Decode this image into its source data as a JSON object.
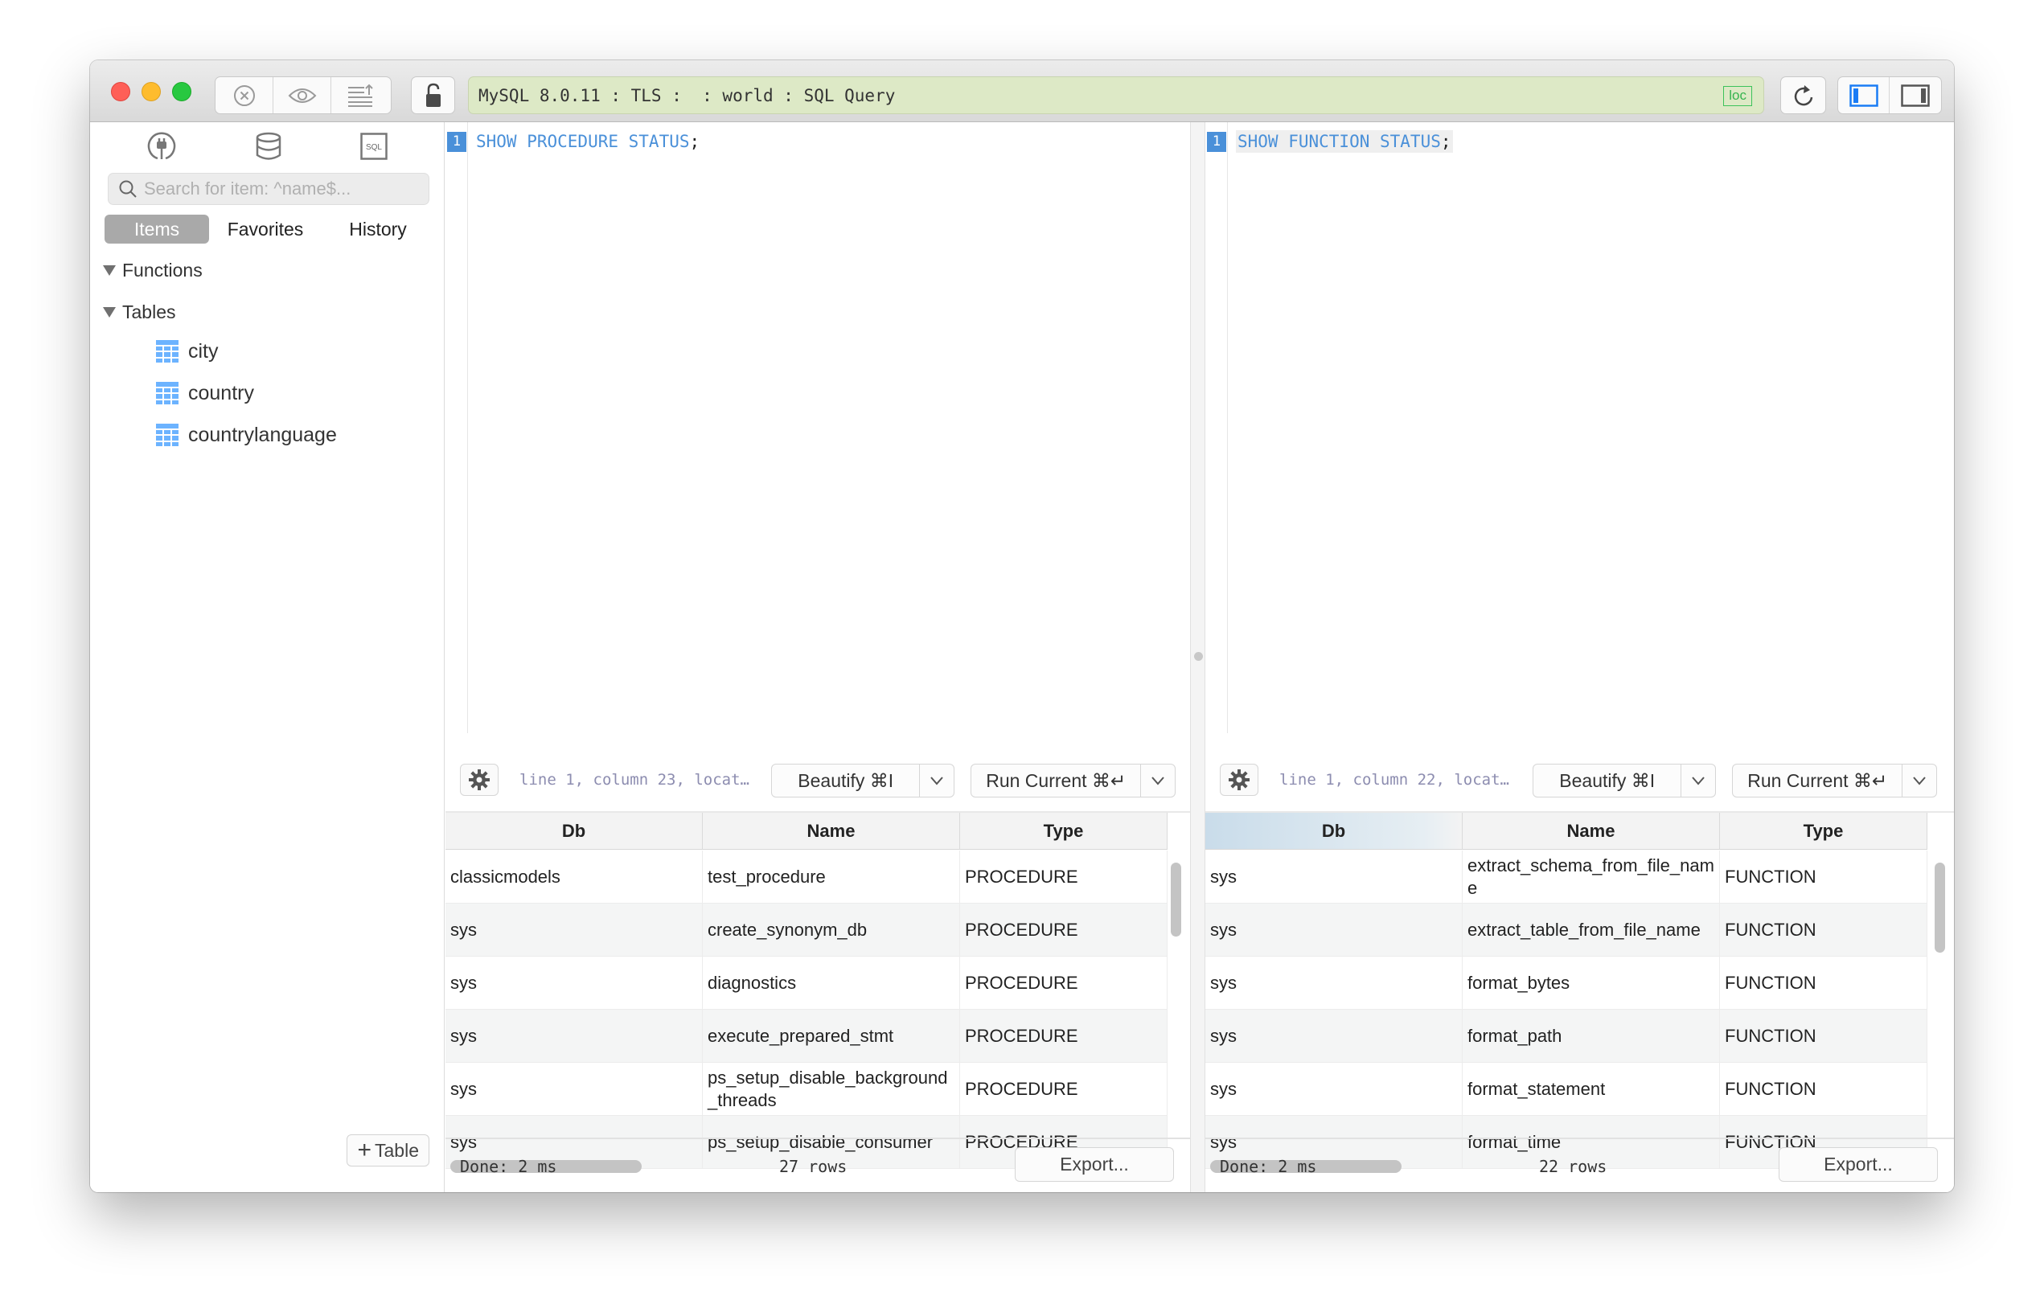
{
  "window": {
    "address": "MySQL 8.0.11 : TLS :  : world : SQL Query",
    "badge": "loc"
  },
  "sidebar": {
    "search_placeholder": "Search for item: ^name$...",
    "tabs": [
      {
        "label": "Items",
        "active": true
      },
      {
        "label": "Favorites",
        "active": false
      },
      {
        "label": "History",
        "active": false
      }
    ],
    "sections": [
      {
        "label": "Functions"
      },
      {
        "label": "Tables"
      }
    ],
    "tables": [
      "city",
      "country",
      "countrylanguage"
    ],
    "add_table_label": "Table",
    "icons": {
      "plus": "+",
      "sql": "SQL"
    }
  },
  "left_pane": {
    "line_number": "1",
    "query_keyword": "SHOW PROCEDURE STATUS",
    "query_end": ";",
    "cursor_status": "line 1, column 23, locat…",
    "beautify_label": "Beautify ⌘I",
    "run_label": "Run Current ⌘↵",
    "columns": [
      "Db",
      "Name",
      "Type"
    ],
    "rows": [
      [
        "classicmodels",
        "test_procedure",
        "PROCEDURE"
      ],
      [
        "sys",
        "create_synonym_db",
        "PROCEDURE"
      ],
      [
        "sys",
        "diagnostics",
        "PROCEDURE"
      ],
      [
        "sys",
        "execute_prepared_stmt",
        "PROCEDURE"
      ],
      [
        "sys",
        "ps_setup_disable_background_threads",
        "PROCEDURE"
      ],
      [
        "sys",
        "ps_setup_disable_consumer",
        "PROCEDURE"
      ]
    ],
    "status_done": "Done: 2 ms",
    "status_rows": "27 rows",
    "export_label": "Export..."
  },
  "right_pane": {
    "line_number": "1",
    "query_keyword": "SHOW FUNCTION STATUS",
    "query_end": ";",
    "cursor_status": "line 1, column 22, locat…",
    "beautify_label": "Beautify ⌘I",
    "run_label": "Run Current ⌘↵",
    "columns": [
      "Db",
      "Name",
      "Type"
    ],
    "rows": [
      [
        "sys",
        "extract_schema_from_file_name",
        "FUNCTION"
      ],
      [
        "sys",
        "extract_table_from_file_name",
        "FUNCTION"
      ],
      [
        "sys",
        "format_bytes",
        "FUNCTION"
      ],
      [
        "sys",
        "format_path",
        "FUNCTION"
      ],
      [
        "sys",
        "format_statement",
        "FUNCTION"
      ],
      [
        "sys",
        "format_time",
        "FUNCTION"
      ]
    ],
    "status_done": "Done: 2 ms",
    "status_rows": "22 rows",
    "export_label": "Export..."
  },
  "colors": {
    "address_bg": "#dde9c6",
    "accent_blue": "#4a90d9",
    "badge_green": "#36b44f",
    "table_icon": "#6cb3ff"
  }
}
